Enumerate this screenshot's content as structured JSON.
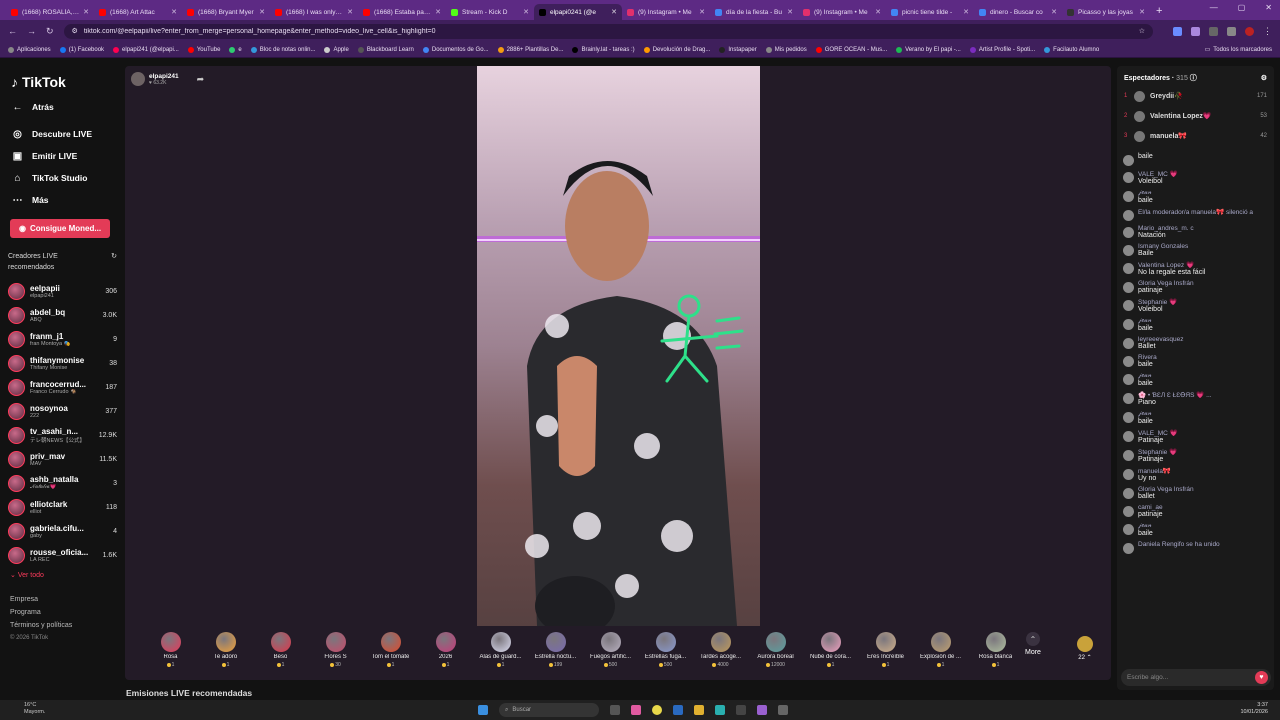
{
  "browser": {
    "tabs": [
      {
        "title": "(1668) ROSALÍA, Yu",
        "color": "#ff0000"
      },
      {
        "title": "(1668) Art Attac",
        "color": "#ff0000"
      },
      {
        "title": "(1668) Bryant Myer",
        "color": "#ff0000"
      },
      {
        "title": "(1668) I was only tw",
        "color": "#ff0000"
      },
      {
        "title": "(1668) Estaba parali",
        "color": "#ff0000"
      },
      {
        "title": "Stream - Kick D",
        "color": "#53fc18"
      },
      {
        "title": "elpapi0241 (@e",
        "color": "#000000",
        "active": true
      },
      {
        "title": "(9) Instagram • Me",
        "color": "#e1306c"
      },
      {
        "title": "día de la fiesta - Bu",
        "color": "#4285f4"
      },
      {
        "title": "(9) Instagram • Me",
        "color": "#e1306c"
      },
      {
        "title": "picnic tiene tilde -",
        "color": "#4285f4"
      },
      {
        "title": "dinero - Buscar co",
        "color": "#4285f4"
      },
      {
        "title": "Picasso y las joyas",
        "color": "#333333"
      }
    ],
    "url": "tiktok.com/@eelpapii/live?enter_from_merge=personal_homepage&enter_method=video_live_cell&is_highlight=0",
    "bookmarks": [
      {
        "label": "Aplicaciones",
        "color": "#888888"
      },
      {
        "label": "(1) Facebook",
        "color": "#1877f2"
      },
      {
        "label": "elpapi241 (@elpapi...",
        "color": "#ff0050"
      },
      {
        "label": "YouTube",
        "color": "#ff0000"
      },
      {
        "label": "e",
        "color": "#2ecc71"
      },
      {
        "label": "Bloc de notas onlin...",
        "color": "#3498db"
      },
      {
        "label": "Apple",
        "color": "#cccccc"
      },
      {
        "label": "Blackboard Learn",
        "color": "#555555"
      },
      {
        "label": "Documentos de Go...",
        "color": "#4285f4"
      },
      {
        "label": "2886+ Plantillas De...",
        "color": "#f39c12"
      },
      {
        "label": "Brainly.lat - tareas :)",
        "color": "#000000"
      },
      {
        "label": "Devolución de Drag...",
        "color": "#ff9900"
      },
      {
        "label": "Instapaper",
        "color": "#222222"
      },
      {
        "label": "Mis pedidos",
        "color": "#888888"
      },
      {
        "label": "GORE OCEAN - Mus...",
        "color": "#ff0000"
      },
      {
        "label": "Verano by El papi -...",
        "color": "#1db954"
      },
      {
        "label": "Artist Profile - Spoti...",
        "color": "#7b2cbf"
      },
      {
        "label": "Facilauto Alumno",
        "color": "#3498db"
      }
    ],
    "bookmarks_all": "Todos los marcadores"
  },
  "sidebar": {
    "logo": "TikTok",
    "nav": [
      {
        "label": "Atrás",
        "icon": "back-arrow-icon"
      },
      {
        "label": "Descubre LIVE",
        "icon": "live-icon"
      },
      {
        "label": "Emitir LIVE",
        "icon": "camera-icon"
      },
      {
        "label": "TikTok Studio",
        "icon": "home-icon"
      },
      {
        "label": "Más",
        "icon": "more-icon"
      }
    ],
    "coins_button": "Consigue Moned...",
    "creators_title": "Creadores LIVE recomendados",
    "creators": [
      {
        "name": "eelpapii",
        "sub": "elpapi241",
        "count": "306"
      },
      {
        "name": "abdel_bq",
        "sub": "ABQ",
        "count": "3.0K"
      },
      {
        "name": "franm_j1",
        "sub": "fran Montoya 🎭",
        "count": "9"
      },
      {
        "name": "thifanymonise",
        "sub": "Thifany Monise",
        "count": "38"
      },
      {
        "name": "francocerrud...",
        "sub": "Franco Cerrudo 🐐",
        "count": "187"
      },
      {
        "name": "nosoynoa",
        "sub": "222",
        "count": "377"
      },
      {
        "name": "tv_asahi_n...",
        "sub": "テレ朝NEWS【公式】",
        "count": "12.9K"
      },
      {
        "name": "priv_mav",
        "sub": "MAV",
        "count": "11.5K"
      },
      {
        "name": "ashb_natalla",
        "sub": "𝒩𝒶𝓉𝒶𝓁𝒾𝒶💗",
        "count": "3"
      },
      {
        "name": "elliotclark",
        "sub": "elliot",
        "count": "118"
      },
      {
        "name": "gabriela.cifu...",
        "sub": "gaby",
        "count": "4"
      },
      {
        "name": "rousse_oficia...",
        "sub": "LA REC",
        "count": "1.6K"
      }
    ],
    "see_all": "Ver todo",
    "footer": [
      "Empresa",
      "Programa",
      "Términos y políticas"
    ],
    "copyright": "© 2026 TikTok"
  },
  "stream": {
    "host_name": "elpapi241",
    "host_likes": "63.2K",
    "gifts": [
      {
        "name": "Rosa",
        "price": "1",
        "color": "#e8395a"
      },
      {
        "name": "Te adoro",
        "price": "1",
        "color": "#f2a33a"
      },
      {
        "name": "Beso",
        "price": "1",
        "color": "#e0364a"
      },
      {
        "name": "Flores S",
        "price": "30",
        "color": "#c94a6a"
      },
      {
        "name": "Tom el tomate",
        "price": "1",
        "color": "#e04a2a"
      },
      {
        "name": "2026",
        "price": "1",
        "color": "#c83a7a"
      },
      {
        "name": "Alas de guard...",
        "price": "1",
        "color": "#dcdcf0"
      },
      {
        "name": "Estrella noctu...",
        "price": "199",
        "color": "#7a6ab0"
      },
      {
        "name": "Fuegos artific...",
        "price": "500",
        "color": "#b8b0c0"
      },
      {
        "name": "Estrellas fuga...",
        "price": "500",
        "color": "#8a9ad0"
      },
      {
        "name": "Tardes acoge...",
        "price": "4000",
        "color": "#c09a5a"
      },
      {
        "name": "Aurora boreal",
        "price": "12000",
        "color": "#5aa0a0"
      },
      {
        "name": "Nube de cora...",
        "price": "1",
        "color": "#f0a0c0"
      },
      {
        "name": "Eres Increíble",
        "price": "1",
        "color": "#d0b08a"
      },
      {
        "name": "Explosión de ...",
        "price": "1",
        "color": "#c0a070"
      },
      {
        "name": "Rosa blanca",
        "price": "1",
        "color": "#b0c0a0"
      }
    ],
    "more_label": "More",
    "wallet_count": "22",
    "recommended_title": "Emisiones LIVE recomendadas"
  },
  "chat": {
    "title": "Espectadores",
    "viewer_count": "315",
    "top_viewers": [
      {
        "rank": "1",
        "name": "Greydii🥀",
        "score": "171"
      },
      {
        "rank": "2",
        "name": "Valentina Lopez💗",
        "score": "53"
      },
      {
        "rank": "3",
        "name": "manuela🎀",
        "score": "42"
      }
    ],
    "messages": [
      {
        "user": "",
        "text": "baile"
      },
      {
        "user": "VALE_MC 💗",
        "text": "Voleibol"
      },
      {
        "user": "𝒿𝑒𝒶𝓃",
        "text": "baile"
      },
      {
        "user": "El/la moderador/a manuela🎀 silenció a",
        "text": ""
      },
      {
        "user": "Mario_andres_m. c",
        "text": "Natación"
      },
      {
        "user": "Ismany Gonzales",
        "text": "Baile"
      },
      {
        "user": "Valentina Lopez 💗",
        "text": "No la regale esta fácil"
      },
      {
        "user": "Gloria Vega Insfrán",
        "text": "patinaje"
      },
      {
        "user": "Stephanie 💗",
        "text": "Voleibol"
      },
      {
        "user": "𝒿𝑒𝒶𝓃",
        "text": "baile"
      },
      {
        "user": "leyreeevasquez",
        "text": "Ballet"
      },
      {
        "user": "Rivera",
        "text": "baile"
      },
      {
        "user": "𝒿𝑒𝒶𝓃",
        "text": "baile"
      },
      {
        "user": "🌸 • ƁƐЛ Ɛ ŁƐꝊЯS 💗 ...",
        "text": "Piano"
      },
      {
        "user": "𝒿𝑒𝒶𝓃",
        "text": "baile"
      },
      {
        "user": "VALE_MC 💗",
        "text": "Patinaje"
      },
      {
        "user": "Stephanie 💗",
        "text": "Patinaje"
      },
      {
        "user": "manuela🎀",
        "text": "Uy no"
      },
      {
        "user": "Gloria Vega Insfrán",
        "text": "ballet"
      },
      {
        "user": "cami_ae",
        "text": "patinaje"
      },
      {
        "user": "𝒿𝑒𝒶𝓃",
        "text": "baile"
      },
      {
        "user": "Daniela Rengifo  se ha unido",
        "text": ""
      }
    ],
    "input_placeholder": "Escribe algo..."
  },
  "taskbar": {
    "weather_temp": "16°C",
    "weather_text": "Mayorm.",
    "search_placeholder": "Buscar",
    "time": "3:37",
    "date": "10/01/2026"
  }
}
